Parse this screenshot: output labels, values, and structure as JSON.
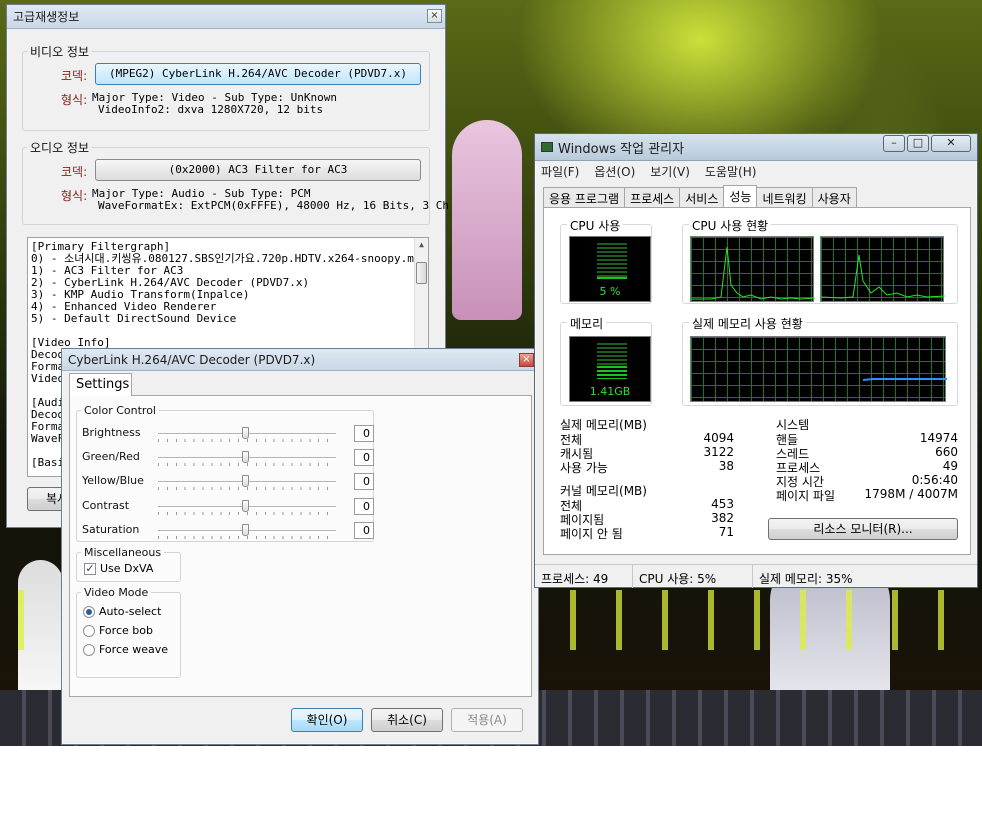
{
  "kmp_window": {
    "title": "고급재생정보",
    "video_group": "비디오 정보",
    "codec_label": "코덱:",
    "video_codec": "(MPEG2) CyberLink H.264/AVC Decoder (PDVD7.x)",
    "format_label": "형식:",
    "video_format_lines": [
      "Major Type: Video - Sub Type: UnKnown",
      "VideoInfo2: dxva 1280X720, 12 bits"
    ],
    "audio_group": "오디오 정보",
    "audio_codec": "(0x2000) AC3 Filter for AC3",
    "audio_format_lines": [
      "Major Type: Audio - Sub Type: PCM",
      "WaveFormatEx: ExtPCM(0xFFFE), 48000 Hz, 16 Bits, 3 Ch"
    ],
    "filter_lines": [
      "[Primary Filtergraph]",
      "0) - 소녀시대.키씽유.080127.SBS인기가요.720p.HDTV.x264-snoopy.mk",
      "1) - AC3 Filter for AC3",
      "2) - CyberLink H.264/AVC Decoder (PDVD7.x)",
      "3) - KMP Audio Transform(Inpalce)",
      "4) - Enhanced Video Renderer",
      "5) - Default DirectSound Device",
      "",
      "[Video Info]",
      "Decod",
      "Forma",
      "Video",
      "",
      "[Audi",
      "Decod",
      "Forma",
      "WaveF",
      "",
      "[Basi"
    ],
    "bottom_button": "복사"
  },
  "cyberlink": {
    "title": "CyberLink H.264/AVC Decoder (PDVD7.x)",
    "tab": "Settings",
    "color_group": "Color Control",
    "sliders": [
      {
        "label": "Brightness",
        "value": "0"
      },
      {
        "label": "Green/Red",
        "value": "0"
      },
      {
        "label": "Yellow/Blue",
        "value": "0"
      },
      {
        "label": "Contrast",
        "value": "0"
      },
      {
        "label": "Saturation",
        "value": "0"
      }
    ],
    "misc_group": "Miscellaneous",
    "use_dxva": "Use DxVA",
    "mode_group": "Video Mode",
    "modes": [
      "Auto-select",
      "Force bob",
      "Force weave"
    ],
    "ok": "확인(O)",
    "cancel": "취소(C)",
    "apply": "적용(A)"
  },
  "taskmgr": {
    "title": "Windows 작업 관리자",
    "menu": [
      "파일(F)",
      "옵션(O)",
      "보기(V)",
      "도움말(H)"
    ],
    "tabs": [
      "응용 프로그램",
      "프로세스",
      "서비스",
      "성능",
      "네트워킹",
      "사용자"
    ],
    "cpu_usage_label": "CPU 사용",
    "cpu_usage_value": "5 %",
    "cpu_history_label": "CPU 사용 현황",
    "memory_label": "메모리",
    "memory_value": "1.41GB",
    "memory_history_label": "실제 메모리 사용 현황",
    "physical_group": "실제 메모리(MB)",
    "physical_rows": [
      {
        "k": "전체",
        "v": "4094"
      },
      {
        "k": "캐시됨",
        "v": "3122"
      },
      {
        "k": "사용 가능",
        "v": "38"
      }
    ],
    "kernel_group": "커널 메모리(MB)",
    "kernel_rows": [
      {
        "k": "전체",
        "v": "453"
      },
      {
        "k": "페이지됨",
        "v": "382"
      },
      {
        "k": "페이지 안 됨",
        "v": "71"
      }
    ],
    "system_group": "시스템",
    "system_rows": [
      {
        "k": "핸들",
        "v": "14974"
      },
      {
        "k": "스레드",
        "v": "660"
      },
      {
        "k": "프로세스",
        "v": "49"
      },
      {
        "k": "지정 시간",
        "v": "0:56:40"
      },
      {
        "k": "페이지 파일",
        "v": "1798M / 4007M"
      }
    ],
    "resource_button": "리소스 모니터(R)...",
    "status": [
      "프로세스: 49",
      "CPU 사용: 5%",
      "실제 메모리: 35%"
    ],
    "cpu_percent": 5,
    "memory_percent": 35
  }
}
